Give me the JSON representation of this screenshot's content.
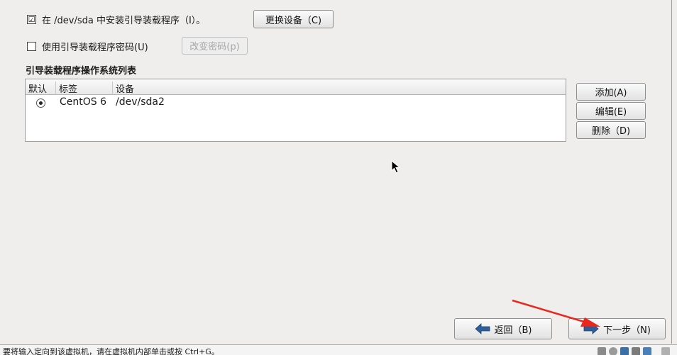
{
  "bootloader": {
    "install_label": "在 /dev/sda 中安装引导装载程序（I）。",
    "install_checked": "☑",
    "change_device": "更换设备（C)",
    "password_label": "使用引导装载程序密码(U)",
    "password_checked": "",
    "change_password": "改变密码(p)"
  },
  "os_list": {
    "title": "引导装载程序操作系统列表",
    "columns": [
      "默认",
      "标签",
      "设备"
    ],
    "rows": [
      {
        "default": true,
        "label": "CentOS 6",
        "device": "/dev/sda2"
      }
    ]
  },
  "side_buttons": {
    "add": "添加(A)",
    "edit": "编辑(E)",
    "delete": "删除（D)"
  },
  "navigation": {
    "back": "返回（B)",
    "next": "下一步（N)"
  },
  "statusbar": {
    "text": "要将输入定向到该虚拟机，请在虚拟机内部单击或按 Ctrl+G。"
  },
  "colors": {
    "arrow_blue": "#2f5f9a",
    "annotation_red": "#e8281e"
  }
}
